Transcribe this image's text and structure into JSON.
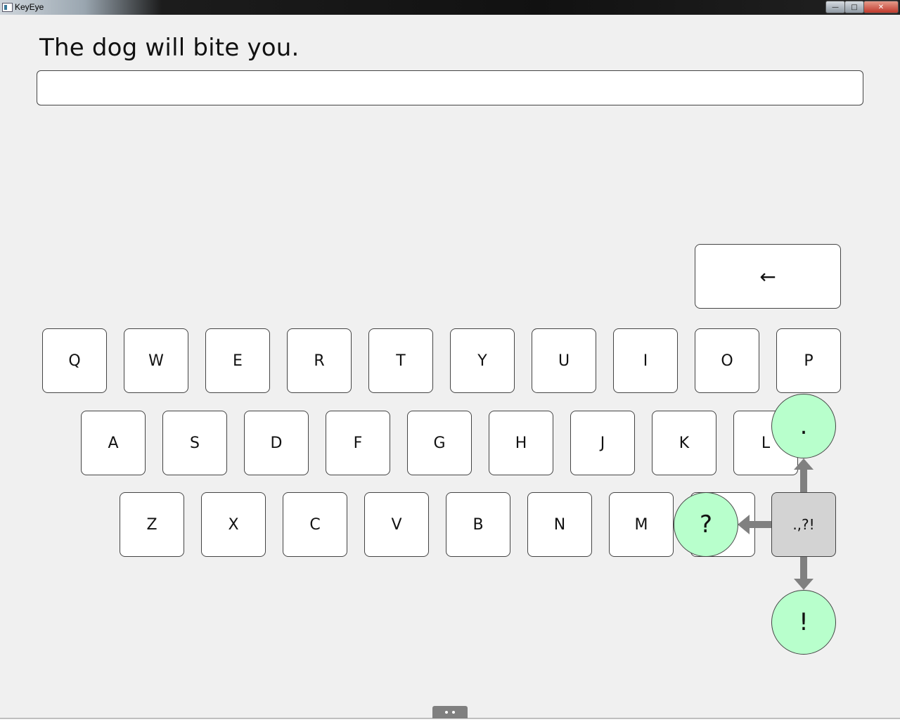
{
  "window": {
    "title": "KeyEye",
    "minimize_symbol": "—",
    "maximize_symbol": "□",
    "close_symbol": "✕"
  },
  "prompt": {
    "sentence": "The dog will bite you."
  },
  "input": {
    "value": ""
  },
  "keyboard": {
    "backspace_label": "←",
    "row1": [
      "Q",
      "W",
      "E",
      "R",
      "T",
      "Y",
      "U",
      "I",
      "O",
      "P"
    ],
    "row2": [
      "A",
      "S",
      "D",
      "F",
      "G",
      "H",
      "J",
      "K",
      "L"
    ],
    "row3": [
      "Z",
      "X",
      "C",
      "V",
      "B",
      "N",
      "M"
    ],
    "punctuation_key_label": ".,?!",
    "punctuation_options": {
      "up": ".",
      "left": "?",
      "down": "!"
    }
  },
  "colors": {
    "background": "#f0f0f0",
    "key_fill": "#ffffff",
    "punct_key_fill": "#d3d3d3",
    "bubble_fill": "#b8ffcc",
    "arrow": "#808080"
  },
  "icons": {
    "app": "app-window-icon",
    "bottom_handle": "drag-handle-icon"
  }
}
